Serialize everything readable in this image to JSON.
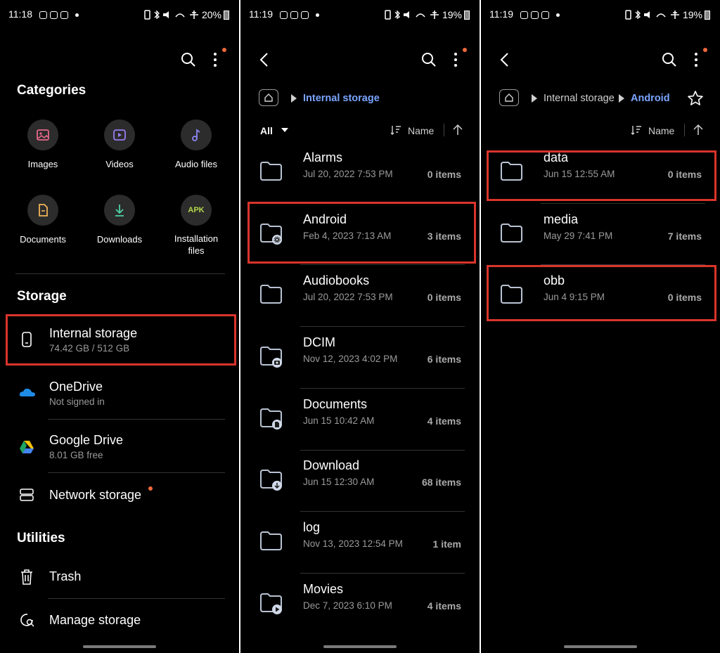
{
  "panel1": {
    "status": {
      "time": "11:18",
      "battery": "20%"
    },
    "categories_title": "Categories",
    "categories": [
      {
        "label": "Images",
        "icon": "image-icon",
        "color": "#e6688a"
      },
      {
        "label": "Videos",
        "icon": "video-icon",
        "color": "#9b7df2"
      },
      {
        "label": "Audio files",
        "icon": "music-note-icon",
        "color": "#8c86f5"
      },
      {
        "label": "Documents",
        "icon": "document-icon",
        "color": "#f0b45a"
      },
      {
        "label": "Downloads",
        "icon": "download-icon",
        "color": "#4fd1a6"
      },
      {
        "label": "Installation files",
        "icon": "apk-icon",
        "color": "#b4d94a",
        "badge": "APK"
      }
    ],
    "storage_title": "Storage",
    "storage": [
      {
        "title": "Internal storage",
        "subtitle": "74.42 GB / 512 GB",
        "icon": "phone-icon"
      },
      {
        "title": "OneDrive",
        "subtitle": "Not signed in",
        "icon": "onedrive-icon"
      },
      {
        "title": "Google Drive",
        "subtitle": "8.01 GB free",
        "icon": "google-drive-icon"
      },
      {
        "title": "Network storage",
        "icon": "server-icon"
      }
    ],
    "utilities_title": "Utilities",
    "utilities": [
      {
        "title": "Trash",
        "icon": "trash-icon"
      },
      {
        "title": "Manage storage",
        "icon": "manage-storage-icon"
      }
    ]
  },
  "panel2": {
    "status": {
      "time": "11:19",
      "battery": "19%"
    },
    "breadcrumb": [
      "Internal storage"
    ],
    "filter": "All",
    "sort": "Name",
    "folders": [
      {
        "name": "Alarms",
        "date": "Jul 20, 2022 7:53 PM",
        "count": "0 items",
        "badge": ""
      },
      {
        "name": "Android",
        "date": "Feb 4, 2023 7:13 AM",
        "count": "3 items",
        "badge": "gear"
      },
      {
        "name": "Audiobooks",
        "date": "Jul 20, 2022 7:53 PM",
        "count": "0 items",
        "badge": ""
      },
      {
        "name": "DCIM",
        "date": "Nov 12, 2023 4:02 PM",
        "count": "6 items",
        "badge": "camera"
      },
      {
        "name": "Documents",
        "date": "Jun 15 10:42 AM",
        "count": "4 items",
        "badge": "doc"
      },
      {
        "name": "Download",
        "date": "Jun 15 12:30 AM",
        "count": "68 items",
        "badge": "download"
      },
      {
        "name": "log",
        "date": "Nov 13, 2023 12:54 PM",
        "count": "1 item",
        "badge": ""
      },
      {
        "name": "Movies",
        "date": "Dec 7, 2023 6:10 PM",
        "count": "4 items",
        "badge": "play"
      }
    ]
  },
  "panel3": {
    "status": {
      "time": "11:19",
      "battery": "19%"
    },
    "breadcrumb": [
      "Internal storage",
      "Android"
    ],
    "sort": "Name",
    "folders": [
      {
        "name": "data",
        "date": "Jun 15 12:55 AM",
        "count": "0 items"
      },
      {
        "name": "media",
        "date": "May 29 7:41 PM",
        "count": "7 items"
      },
      {
        "name": "obb",
        "date": "Jun 4 9:15 PM",
        "count": "0 items"
      }
    ]
  },
  "colors": {
    "accent": "#7aa4ff",
    "highlight": "#d9342b",
    "notify": "#f06a3a"
  }
}
